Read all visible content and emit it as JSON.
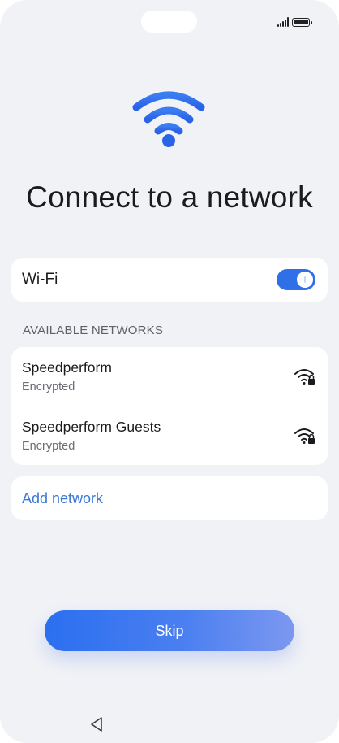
{
  "status_bar": {
    "signal_icon": "signal-icon",
    "battery_icon": "battery-icon"
  },
  "hero": {
    "icon": "wifi-icon",
    "title": "Connect to a network"
  },
  "wifi_toggle": {
    "label": "Wi-Fi",
    "enabled": true
  },
  "available_networks": {
    "header": "AVAILABLE NETWORKS",
    "items": [
      {
        "name": "Speedperform",
        "status": "Encrypted",
        "icon": "wifi-locked-icon"
      },
      {
        "name": "Speedperform Guests",
        "status": "Encrypted",
        "icon": "wifi-locked-icon"
      }
    ]
  },
  "add_network": {
    "label": "Add network"
  },
  "skip_button": {
    "label": "Skip"
  },
  "nav": {
    "back_icon": "back-triangle-icon"
  },
  "colors": {
    "accent": "#2f6fe8",
    "link": "#3a78d8",
    "background": "#f1f2f6"
  }
}
